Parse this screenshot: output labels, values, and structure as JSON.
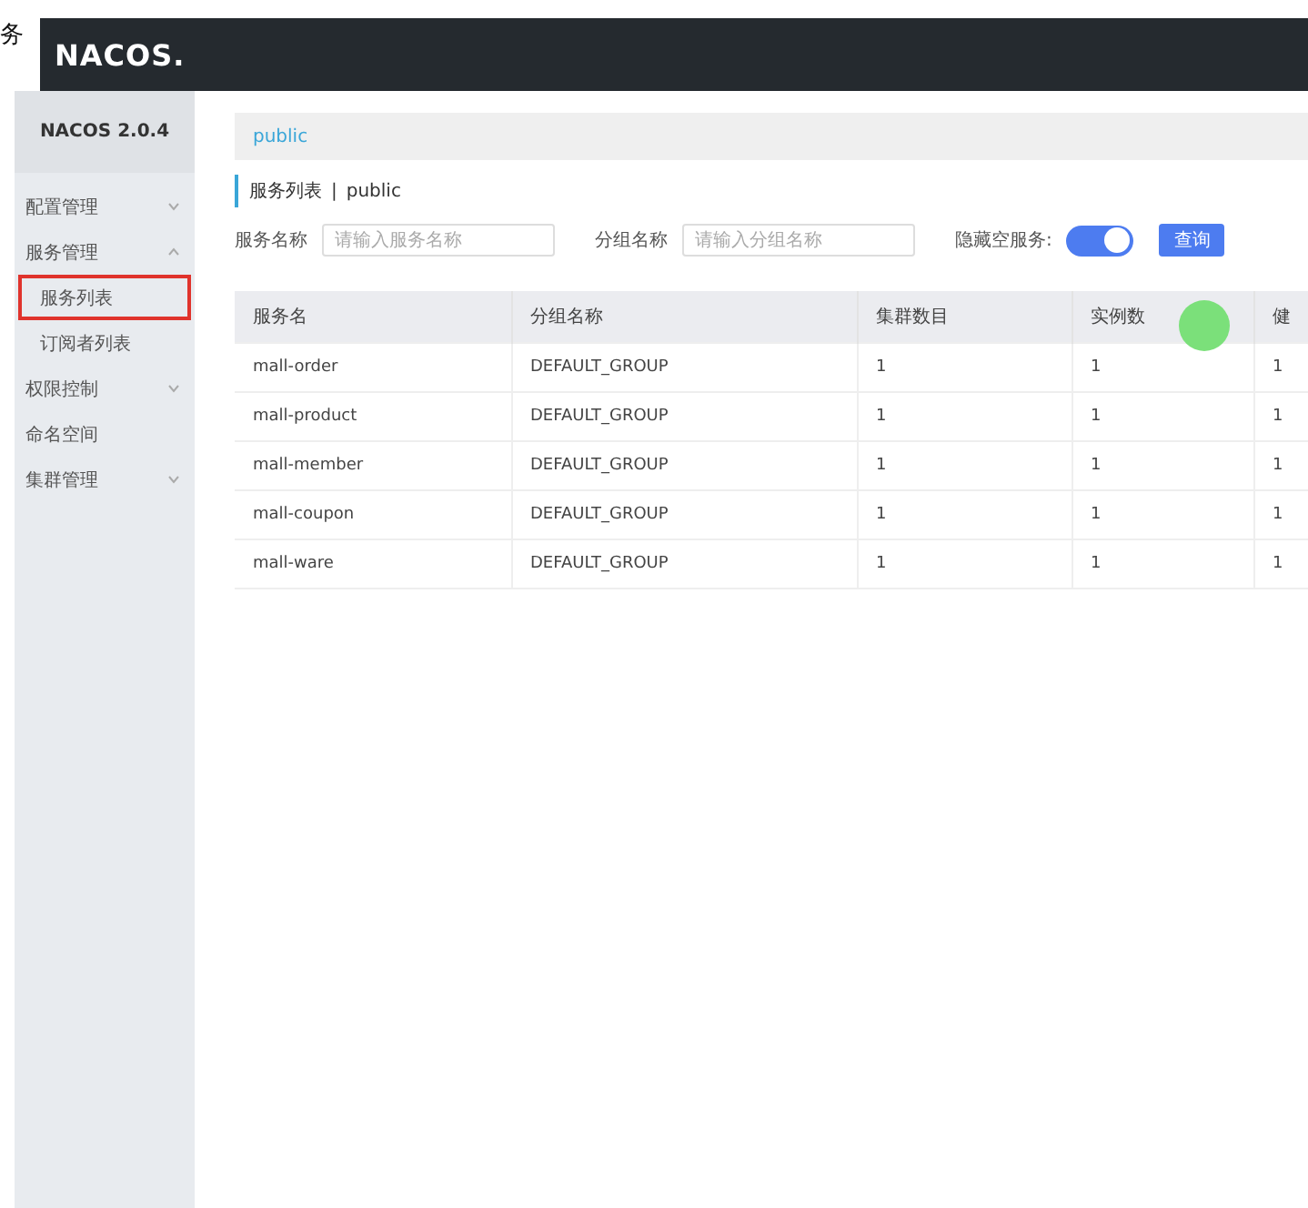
{
  "edge_text": "务",
  "header": {
    "logo": "NACOS."
  },
  "sidebar": {
    "version": "NACOS 2.0.4",
    "items": [
      {
        "label": "配置管理",
        "expanded": false
      },
      {
        "label": "服务管理",
        "expanded": true,
        "children": [
          {
            "label": "服务列表",
            "selected": true
          },
          {
            "label": "订阅者列表",
            "selected": false
          }
        ]
      },
      {
        "label": "权限控制",
        "expanded": false
      },
      {
        "label": "命名空间",
        "kind": "leaf"
      },
      {
        "label": "集群管理",
        "expanded": false
      }
    ]
  },
  "namespace_bar": {
    "namespace": "public"
  },
  "page_title": {
    "title": "服务列表",
    "separator": "|",
    "namespace": "public"
  },
  "filters": {
    "service_label": "服务名称",
    "service_placeholder": "请输入服务名称",
    "group_label": "分组名称",
    "group_placeholder": "请输入分组名称",
    "hide_empty_label": "隐藏空服务:",
    "hide_empty_on": true,
    "query_button": "查询"
  },
  "table": {
    "columns": [
      "服务名",
      "分组名称",
      "集群数目",
      "实例数",
      "健"
    ],
    "rows": [
      [
        "mall-order",
        "DEFAULT_GROUP",
        "1",
        "1",
        "1"
      ],
      [
        "mall-product",
        "DEFAULT_GROUP",
        "1",
        "1",
        "1"
      ],
      [
        "mall-member",
        "DEFAULT_GROUP",
        "1",
        "1",
        "1"
      ],
      [
        "mall-coupon",
        "DEFAULT_GROUP",
        "1",
        "1",
        "1"
      ],
      [
        "mall-ware",
        "DEFAULT_GROUP",
        "1",
        "1",
        "1"
      ]
    ]
  }
}
